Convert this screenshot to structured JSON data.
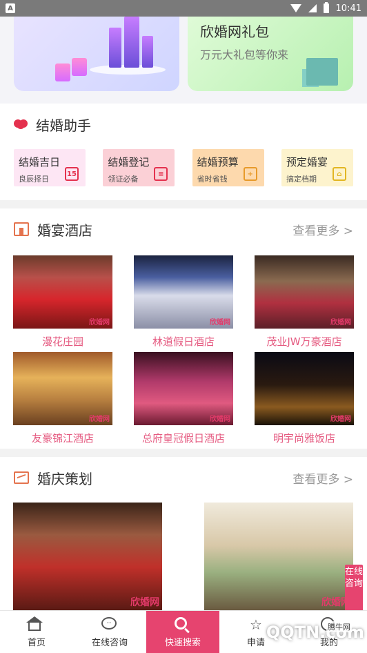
{
  "status_bar": {
    "time": "10:41",
    "app_badge": "A"
  },
  "banner": {
    "gift_title": "欣婚网礼包",
    "gift_subtitle": "万元大礼包等你来"
  },
  "assistant": {
    "title": "结婚助手",
    "items": [
      {
        "title": "结婚吉日",
        "subtitle": "良辰择日",
        "icon": "calendar-icon",
        "icon_text": "15",
        "bg": "#fde6f4",
        "color": "#e4314e"
      },
      {
        "title": "结婚登记",
        "subtitle": "领证必备",
        "icon": "clipboard-icon",
        "icon_text": "≡",
        "bg": "#fbd0d6",
        "color": "#e4314e"
      },
      {
        "title": "结婚预算",
        "subtitle": "省时省钱",
        "icon": "calculator-icon",
        "icon_text": "+",
        "bg": "#fdd9ad",
        "color": "#e79a2a"
      },
      {
        "title": "预定婚宴",
        "subtitle": "搞定档期",
        "icon": "dome-icon",
        "icon_text": "⌂",
        "bg": "#fdf3cd",
        "color": "#e2b622"
      }
    ]
  },
  "hotels": {
    "title": "婚宴酒店",
    "more": "查看更多 >",
    "items": [
      {
        "name": "漫花庄园",
        "photo": "linear-gradient(180deg,#6b3b2b 0%,#b8504a 30%,#d7262c 60%,#7a1616 100%)"
      },
      {
        "name": "林道假日酒店",
        "photo": "linear-gradient(180deg,#1b2340 0%,#4a5fa0 30%,#d9dcea 55%,#8b8fa6 100%)"
      },
      {
        "name": "茂业JW万豪酒店",
        "photo": "linear-gradient(180deg,#3a2a22 0%,#8a6a50 35%,#b03040 65%,#5b2028 100%)"
      },
      {
        "name": "友豪锦江酒店",
        "photo": "linear-gradient(180deg,#a05a2a 0%,#e6b25a 35%,#b88040 65%,#6a4020 100%)"
      },
      {
        "name": "总府皇冠假日酒店",
        "photo": "linear-gradient(180deg,#3a1020 0%,#b03a6a 40%,#e05a80 70%,#6a1a30 100%)"
      },
      {
        "name": "明宇尚雅饭店",
        "photo": "linear-gradient(180deg,#0a0a14 0%,#2a1a10 45%,#8a5a20 75%,#1a1208 100%)"
      }
    ],
    "watermark": "欣婚网"
  },
  "planning": {
    "title": "婚庆策划",
    "more": "查看更多 >",
    "photos": [
      {
        "photo": "linear-gradient(180deg,#3a2418 0%,#9a5a40 30%,#c0302a 60%,#5a1a14 100%)"
      },
      {
        "photo": "linear-gradient(180deg,#f0eadc 0%,#d8c8a8 40%,#9ab080 65%,#6a5a40 100%)"
      }
    ],
    "watermark": "欣婚网"
  },
  "float_button": "在线咨询",
  "tabbar": {
    "items": [
      {
        "label": "首页",
        "icon": "home-icon"
      },
      {
        "label": "在线咨询",
        "icon": "chat-icon"
      },
      {
        "label": "快速搜索",
        "icon": "search-icon"
      },
      {
        "label": "申请",
        "icon": "star-icon"
      },
      {
        "label": "我的",
        "icon": "user-icon"
      }
    ]
  },
  "site_watermark": {
    "text": "QQTN.com",
    "small": "腾牛网"
  }
}
